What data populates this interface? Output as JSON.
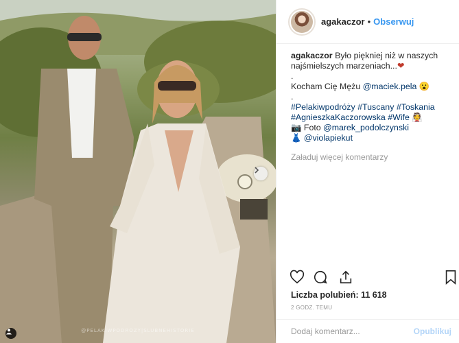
{
  "post": {
    "photo_alt": "",
    "watermark": "@PELAKIWPODROZY|SLUBNEHISTORIE"
  },
  "header": {
    "username": "agakaczor",
    "separator": "•",
    "follow_label": "Obserwuj"
  },
  "caption": {
    "username": "agakaczor",
    "line1_text": " Było piękniej niż w naszych",
    "line2_text": "najśmielszych marzeniach...",
    "heart": "❤",
    "dot1": ".",
    "line4_text": "Kocham Cię Mężu ",
    "mention_husband": "@maciek.pela",
    "emoji_face": "😮",
    "dot2": ".",
    "hashtags_line1": [
      "#Pelakiwpodróży",
      "#Tuscany",
      "#Toskania"
    ],
    "hashtags_line2": [
      "#AgnieszkaKaczorowska",
      "#Wife"
    ],
    "emoji_wife": "👰",
    "camera_emoji": "📷",
    "photo_label": " Foto ",
    "mention_photographer": "@marek_podolczynski",
    "dress_emoji": "👗",
    "mention_dress": "@violapiekut"
  },
  "load_more_label": "Załaduj więcej komentarzy",
  "likes": {
    "label": "Liczba polubień: ",
    "count": "11 618"
  },
  "time_label": "2 GODZ. TEMU",
  "comment_box": {
    "placeholder": "Dodaj komentarz...",
    "post_label": "Opublikuj"
  }
}
